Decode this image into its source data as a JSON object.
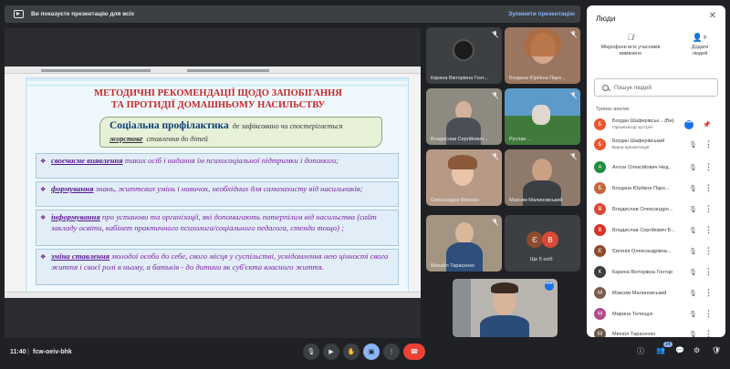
{
  "banner": {
    "text": "Ви показуєте презентацію для всіх",
    "stop_label": "Зупинити презентацію"
  },
  "slide": {
    "title_line1": "МЕТОДИЧНІ РЕКОМЕНДАЦІЇ ЩОДО ЗАПОБІГАННЯ",
    "title_line2": "ТА ПРОТИДІЇ ДОМАШНЬОМУ НАСИЛЬСТВУ",
    "scroll_bold": "Соціальна профілактика",
    "scroll_text1": "де зафіксовано чи спостерігається",
    "scroll_text2": "жорстоке",
    "scroll_text3": "ставлення до дітей",
    "items": [
      {
        "term": "своєчасне виявлення",
        "text": " таких осіб і надання їм психосоціальної підтримки і допомоги;"
      },
      {
        "term": "формування",
        "text": " знань, життєвих умінь і навичок, необхідних для самозахисту від насильників;"
      },
      {
        "term": "інформування",
        "text": " про установи та організації, які допомагають потерпілим від насильства (сайт закладу освіти, кабінет практичного психолога/соціального педагога, стенди тощо) ;"
      },
      {
        "term": "зміна ставлення",
        "text": " молодої особи до себе, свого місця у суспільстві, усвідомлення нею цінності свого життя і своєї ролі в ньому, а батьків - до дитини як суб'єкта власного життя."
      }
    ]
  },
  "tiles": [
    {
      "name": "Карина Вікторівна Гонт..."
    },
    {
      "name": "Богдана Юріївна Парх..."
    },
    {
      "name": "Владислав Сергійович..."
    },
    {
      "name": "Руслан ..."
    },
    {
      "name": "Олександра Філенко"
    },
    {
      "name": "Максим Малиновський"
    },
    {
      "name": "Михайл Тарасенко"
    },
    {
      "name": "Ще 5 осіб",
      "initials": [
        "Є",
        "В"
      ]
    }
  ],
  "panel": {
    "title": "Люди",
    "mute_all_label1": "Мікрофони всіх учасників",
    "mute_all_label2": "вимкнено",
    "add_label1": "Додати",
    "add_label2": "людей",
    "search_placeholder": "Пошук людей",
    "section": "Триває виклик",
    "people": [
      {
        "initial": "Б",
        "color": "#e8572f",
        "name": "Богдан Шаферівськ... (Ви)",
        "sub": "Організатор зустрічі"
      },
      {
        "initial": "Б",
        "color": "#e8572f",
        "name": "Богдан Шаферівський",
        "sub": "Ваша презентація"
      },
      {
        "initial": "А",
        "color": "#1e8e3e",
        "name": "Антон Олексійович Нед..."
      },
      {
        "initial": "Б",
        "color": "#c5653a",
        "name": "Богдана Юріївна Парх..."
      },
      {
        "initial": "В",
        "color": "#d84a38",
        "name": "Владислав Олександро..."
      },
      {
        "initial": "В",
        "color": "#d93025",
        "name": "Владислав Сергійович Б..."
      },
      {
        "initial": "Є",
        "color": "#8d4b2e",
        "name": "Євгенія Олександрівна..."
      },
      {
        "initial": "К",
        "color": "#3b3b3b",
        "name": "Карина Вікторівна Гонтар"
      },
      {
        "initial": "М",
        "color": "#7a5a4a",
        "name": "Максим Малиновський"
      },
      {
        "initial": "М",
        "color": "#b04a8a",
        "name": "Марина Телещук"
      },
      {
        "initial": "М",
        "color": "#6d5a4a",
        "name": "Михаїл Тарасенко"
      }
    ]
  },
  "bottombar": {
    "time": "11:40",
    "separator": "|",
    "code": "fcw-oeiv-bhk",
    "people_count": "14"
  },
  "colors": {
    "end_call": "#ea4335",
    "present": "#8ab4f8"
  }
}
